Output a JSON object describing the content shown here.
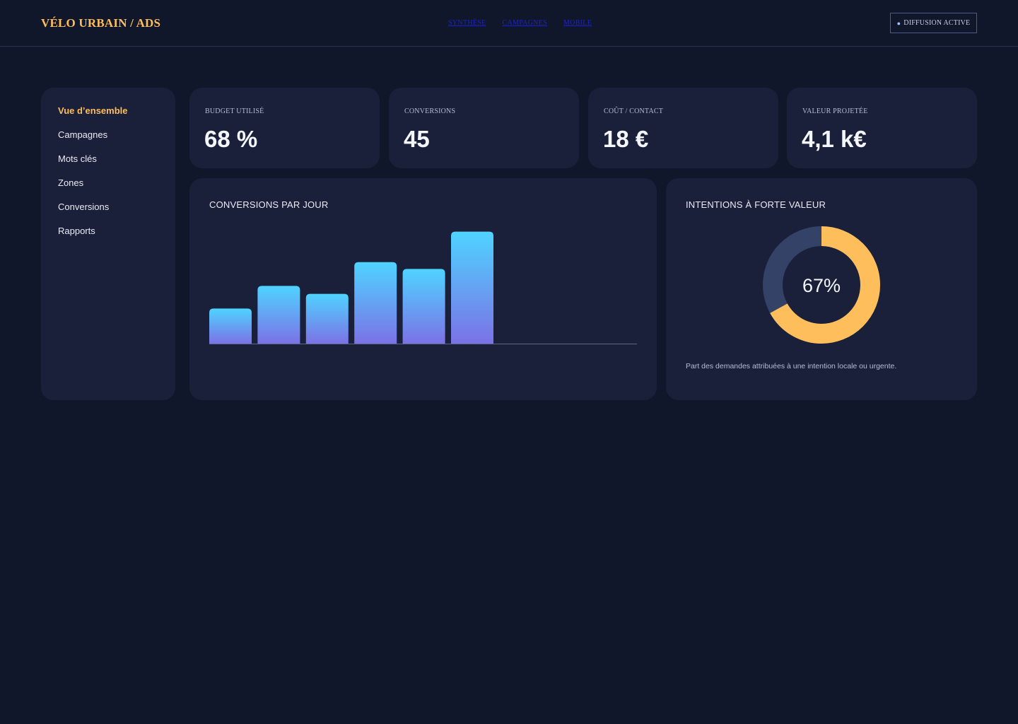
{
  "header": {
    "brand": "VÉLO URBAIN / ADS",
    "nav": [
      "SYNTHÈSE",
      "CAMPAGNES",
      "MOBILE"
    ],
    "status": "DIFFUSION ACTIVE"
  },
  "sidebar": {
    "items": [
      {
        "label": "Vue d’ensemble",
        "active": true
      },
      {
        "label": "Campagnes",
        "active": false
      },
      {
        "label": "Mots clés",
        "active": false
      },
      {
        "label": "Zones",
        "active": false
      },
      {
        "label": "Conversions",
        "active": false
      },
      {
        "label": "Rapports",
        "active": false
      }
    ]
  },
  "kpis": [
    {
      "label": "BUDGET UTILISÉ",
      "value": "68 %"
    },
    {
      "label": "CONVERSIONS",
      "value": "45"
    },
    {
      "label": "COÛT / CONTACT",
      "value": "18 €"
    },
    {
      "label": "VALEUR PROJETÉE",
      "value": "4,1 k€"
    }
  ],
  "conversions_chart": {
    "title": "CONVERSIONS PAR JOUR"
  },
  "intent_card": {
    "title": "INTENTIONS À FORTE VALEUR",
    "center_label": "67%",
    "caption": "Part des demandes attribuées à une intention locale ou urgente."
  },
  "colors": {
    "background": "#11172b",
    "panel": "#1a2039",
    "accent": "#ffbe5c",
    "bar_top": "#4fd3ff",
    "bar_bottom": "#7b72e6",
    "donut_track": "#334266"
  },
  "chart_data": [
    {
      "type": "bar",
      "title": "CONVERSIONS PAR JOUR",
      "categories": [],
      "values": [
        31,
        51,
        44,
        72,
        66,
        99
      ],
      "ylim": [
        0,
        100
      ],
      "grid": false,
      "legend": "none"
    },
    {
      "type": "pie",
      "title": "INTENTIONS À FORTE VALEUR",
      "values": [
        67,
        33
      ],
      "center_label": "67%"
    }
  ]
}
